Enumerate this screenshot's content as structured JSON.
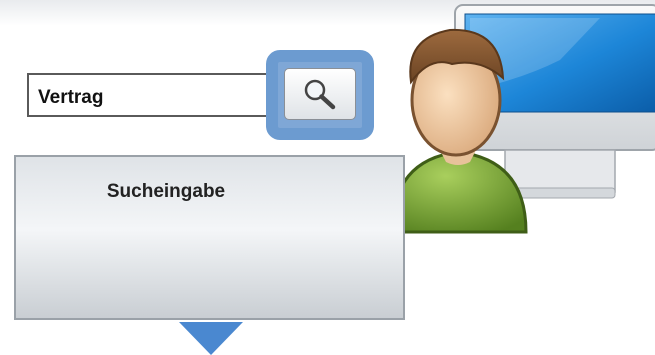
{
  "search_panel": {
    "title": "Sucheingabe",
    "query_value": "Vertrag"
  },
  "icons": {
    "search_button": "magnifier-icon",
    "monitor": "monitor-icon",
    "user": "user-avatar-icon",
    "direction": "arrow-down-icon"
  },
  "colors": {
    "highlight": "#6c9bd0",
    "screen": "#1f86d6",
    "shirt": "#6e9a2c",
    "arrow": "#4a88d0"
  }
}
